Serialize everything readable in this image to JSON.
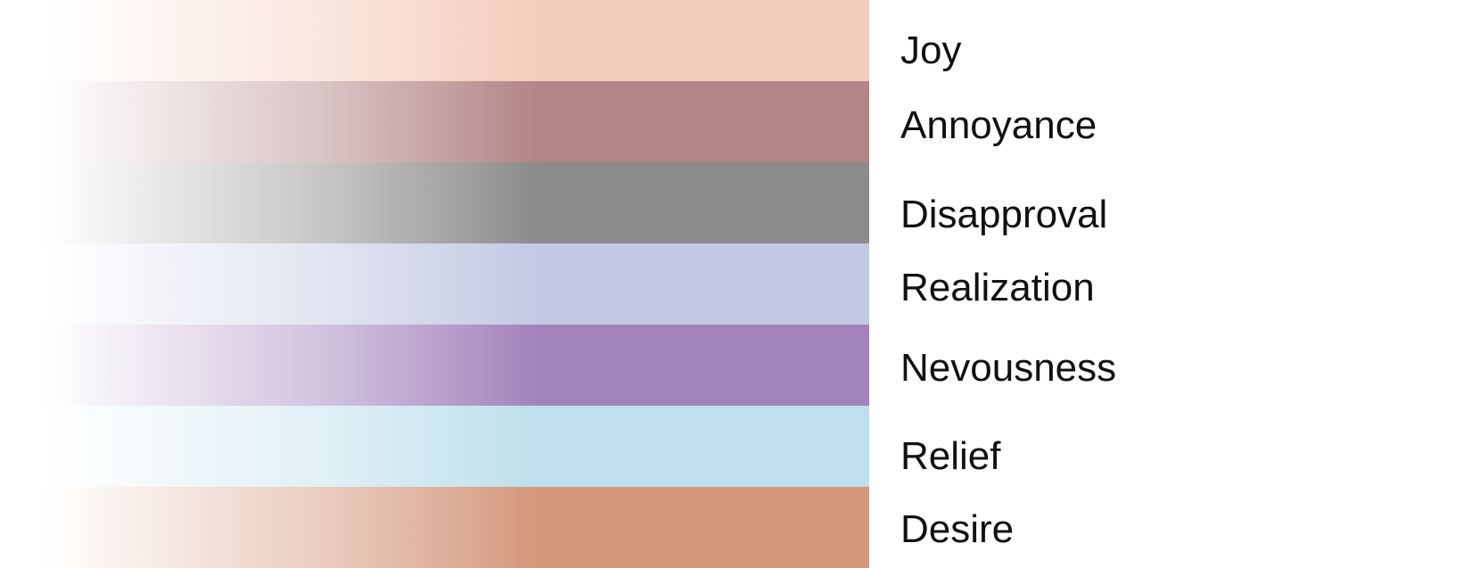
{
  "emotions": [
    {
      "label": "Joy",
      "color": "#f4ccbb"
    },
    {
      "label": "Annoyance",
      "color": "#b38586"
    },
    {
      "label": "Disapproval",
      "color": "#8a8b8a"
    },
    {
      "label": "Realization",
      "color": "#c3c9e3"
    },
    {
      "label": "Nevousness",
      "color": "#a383bb"
    },
    {
      "label": "Relief",
      "color": "#bee0ec"
    },
    {
      "label": "Desire",
      "color": "#d4977b"
    }
  ]
}
